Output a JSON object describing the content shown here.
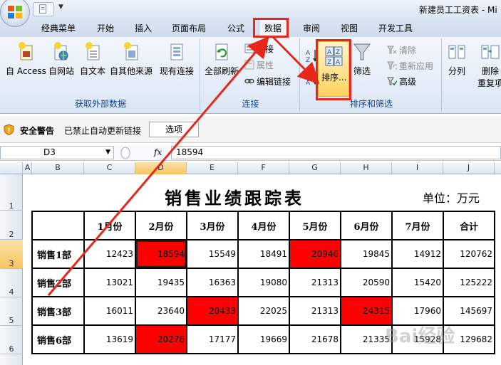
{
  "window": {
    "title": "新建员工工资表 - Mi"
  },
  "tabs": [
    {
      "label": "经典菜单"
    },
    {
      "label": "开始"
    },
    {
      "label": "插入"
    },
    {
      "label": "页面布局"
    },
    {
      "label": "公式"
    },
    {
      "label": "数据"
    },
    {
      "label": "审阅"
    },
    {
      "label": "视图"
    },
    {
      "label": "开发工具"
    }
  ],
  "active_tab": "数据",
  "ribbon": {
    "external": {
      "label": "获取外部数据",
      "from_access": "自 Access",
      "from_web": "自网站",
      "from_text": "自文本",
      "from_other": "自其他来源",
      "existing": "现有连接"
    },
    "connections": {
      "label": "连接",
      "refresh_all": "全部刷新",
      "connections": "连接",
      "properties": "属性",
      "edit_links": "编辑链接"
    },
    "sort_filter": {
      "label": "排序和筛选",
      "sort": "排序...",
      "filter": "筛选",
      "clear": "清除",
      "reapply": "重新应用",
      "advanced": "高级"
    },
    "tools": {
      "split": "分列",
      "remove": "删除",
      "remove_dup": "重复项"
    }
  },
  "security": {
    "title": "安全警告",
    "message": "已禁止自动更新链接",
    "options": "选项"
  },
  "formula_bar": {
    "name_box": "D3",
    "fx": "fx",
    "value": "18594"
  },
  "grid": {
    "columns": [
      "A",
      "B",
      "C",
      "D",
      "E",
      "F",
      "G",
      "H",
      "I",
      "J"
    ],
    "rows": [
      "1",
      "2",
      "3",
      "4",
      "5",
      "6"
    ]
  },
  "sheet": {
    "title": "销售业绩跟踪表",
    "unit": "单位：万元",
    "headers": [
      "",
      "1月份",
      "2月份",
      "3月份",
      "4月份",
      "5月份",
      "6月份",
      "7月份",
      "合计"
    ],
    "rows": [
      {
        "label": "销售1部",
        "values": [
          "12423",
          "18594",
          "15549",
          "18491",
          "20946",
          "19845",
          "14912",
          "120762"
        ]
      },
      {
        "label": "销售2部",
        "values": [
          "13021",
          "19435",
          "16363",
          "19080",
          "21313",
          "20590",
          "15420",
          "125222"
        ]
      },
      {
        "label": "销售3部",
        "values": [
          "16011",
          "23640",
          "20433",
          "22025",
          "21313",
          "24315",
          "17960",
          "145697"
        ]
      },
      {
        "label": "销售6部",
        "values": [
          "13619",
          "20276",
          "17177",
          "19669",
          "21678",
          "21335",
          "15928",
          "129682"
        ]
      }
    ],
    "red_cells": [
      [
        0,
        1
      ],
      [
        0,
        4
      ],
      [
        2,
        2
      ],
      [
        2,
        5
      ],
      [
        3,
        1
      ]
    ]
  },
  "watermark": "Bai经验",
  "colors": {
    "highlight_red": "#ff0000",
    "annotation_red": "#e8271b"
  }
}
